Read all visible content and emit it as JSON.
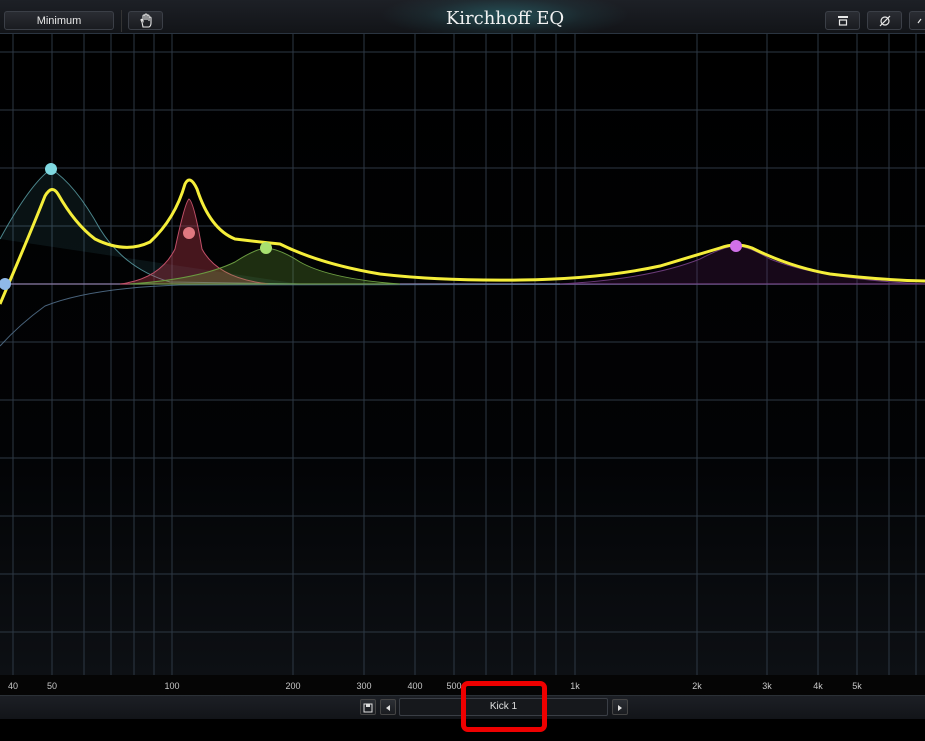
{
  "app": {
    "title": "Kirchhoff EQ"
  },
  "toolbar": {
    "phase_mode": "Minimum",
    "hand_tool_icon": "hand-icon",
    "icons_right": [
      "band-shape-icon",
      "phase-invert-icon"
    ]
  },
  "freq_axis": {
    "ticks": [
      {
        "label": "40",
        "hz": 40
      },
      {
        "label": "50",
        "hz": 50
      },
      {
        "label": "100",
        "hz": 100
      },
      {
        "label": "200",
        "hz": 200
      },
      {
        "label": "300",
        "hz": 300
      },
      {
        "label": "400",
        "hz": 400
      },
      {
        "label": "500",
        "hz": 500
      },
      {
        "label": "1k",
        "hz": 1000
      },
      {
        "label": "2k",
        "hz": 2000
      },
      {
        "label": "3k",
        "hz": 3000
      },
      {
        "label": "4k",
        "hz": 4000
      },
      {
        "label": "5k",
        "hz": 5000
      }
    ]
  },
  "bands": [
    {
      "name": "band-1",
      "type": "high-pass",
      "freq_hz": 37,
      "color": "#8fb8e8"
    },
    {
      "name": "band-2",
      "type": "bell",
      "freq_hz": 50,
      "color": "#7fd8e0"
    },
    {
      "name": "band-3",
      "type": "bell",
      "freq_hz": 115,
      "color": "#e07880"
    },
    {
      "name": "band-4",
      "type": "bell",
      "freq_hz": 170,
      "color": "#a8e070"
    },
    {
      "name": "band-5",
      "type": "bell",
      "freq_hz": 2600,
      "color": "#d070e8"
    }
  ],
  "colors": {
    "curve": "#f5ee3a",
    "grid": "#2d3844",
    "background": "#000000"
  },
  "preset": {
    "save_icon": "save-icon",
    "prev_icon": "triangle-left-icon",
    "next_icon": "triangle-right-icon",
    "name": "Kick 1"
  }
}
